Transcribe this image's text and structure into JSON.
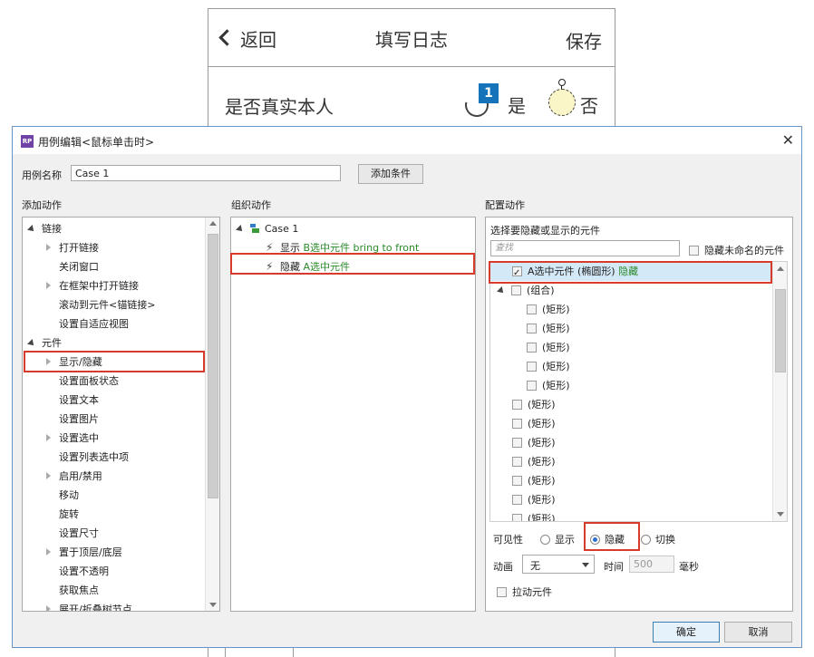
{
  "phone": {
    "back": "返回",
    "title": "填写日志",
    "save": "保存",
    "question": "是否真实本人",
    "badge": "1",
    "yes": "是",
    "no": "否"
  },
  "dialog": {
    "logo": "RP",
    "title": "用例编辑<鼠标单击时>",
    "close": "✕",
    "case_name_label": "用例名称",
    "case_name_value": "Case 1",
    "add_condition": "添加条件",
    "add_action_header": "添加动作",
    "organize_header": "组织动作",
    "configure_header": "配置动作",
    "add_action_tree": [
      {
        "label": "链接",
        "level": 0,
        "toggle": "open"
      },
      {
        "label": "打开链接",
        "level": 1,
        "toggle": "closed"
      },
      {
        "label": "关闭窗口",
        "level": 1,
        "toggle": "none"
      },
      {
        "label": "在框架中打开链接",
        "level": 1,
        "toggle": "closed"
      },
      {
        "label": "滚动到元件<锚链接>",
        "level": 1,
        "toggle": "none"
      },
      {
        "label": "设置自适应视图",
        "level": 1,
        "toggle": "none"
      },
      {
        "label": "元件",
        "level": 0,
        "toggle": "open"
      },
      {
        "label": "显示/隐藏",
        "level": 1,
        "toggle": "closed"
      },
      {
        "label": "设置面板状态",
        "level": 1,
        "toggle": "none"
      },
      {
        "label": "设置文本",
        "level": 1,
        "toggle": "none"
      },
      {
        "label": "设置图片",
        "level": 1,
        "toggle": "none"
      },
      {
        "label": "设置选中",
        "level": 1,
        "toggle": "closed"
      },
      {
        "label": "设置列表选中项",
        "level": 1,
        "toggle": "none"
      },
      {
        "label": "启用/禁用",
        "level": 1,
        "toggle": "closed"
      },
      {
        "label": "移动",
        "level": 1,
        "toggle": "none"
      },
      {
        "label": "旋转",
        "level": 1,
        "toggle": "none"
      },
      {
        "label": "设置尺寸",
        "level": 1,
        "toggle": "none"
      },
      {
        "label": "置于顶层/底层",
        "level": 1,
        "toggle": "closed"
      },
      {
        "label": "设置不透明",
        "level": 1,
        "toggle": "none"
      },
      {
        "label": "获取焦点",
        "level": 1,
        "toggle": "none"
      },
      {
        "label": "展开/折叠树节点",
        "level": 1,
        "toggle": "closed"
      }
    ],
    "organize": {
      "case_label": "Case 1",
      "actions": [
        {
          "verb": "显示",
          "target": "B选中元件 bring to front"
        },
        {
          "verb": "隐藏",
          "target": "A选中元件"
        }
      ]
    },
    "configure": {
      "select_label": "选择要隐藏或显示的元件",
      "search_placeholder": "查找",
      "hide_unnamed": "隐藏未命名的元件",
      "widgets": [
        {
          "label": "A选中元件 (椭圆形)",
          "status": "隐藏",
          "checked": true,
          "level": 0,
          "toggle": "none"
        },
        {
          "label": "(组合)",
          "status": "",
          "checked": false,
          "level": 0,
          "toggle": "open"
        },
        {
          "label": "(矩形)",
          "status": "",
          "checked": false,
          "level": 1,
          "toggle": "none"
        },
        {
          "label": "(矩形)",
          "status": "",
          "checked": false,
          "level": 1,
          "toggle": "none"
        },
        {
          "label": "(矩形)",
          "status": "",
          "checked": false,
          "level": 1,
          "toggle": "none"
        },
        {
          "label": "(矩形)",
          "status": "",
          "checked": false,
          "level": 1,
          "toggle": "none"
        },
        {
          "label": "(矩形)",
          "status": "",
          "checked": false,
          "level": 1,
          "toggle": "none"
        },
        {
          "label": "(矩形)",
          "status": "",
          "checked": false,
          "level": 0,
          "toggle": "none"
        },
        {
          "label": "(矩形)",
          "status": "",
          "checked": false,
          "level": 0,
          "toggle": "none"
        },
        {
          "label": "(矩形)",
          "status": "",
          "checked": false,
          "level": 0,
          "toggle": "none"
        },
        {
          "label": "(矩形)",
          "status": "",
          "checked": false,
          "level": 0,
          "toggle": "none"
        },
        {
          "label": "(矩形)",
          "status": "",
          "checked": false,
          "level": 0,
          "toggle": "none"
        },
        {
          "label": "(矩形)",
          "status": "",
          "checked": false,
          "level": 0,
          "toggle": "none"
        },
        {
          "label": "(矩形)",
          "status": "",
          "checked": false,
          "level": 0,
          "toggle": "none"
        }
      ],
      "visibility_label": "可见性",
      "visibility_options": [
        "显示",
        "隐藏",
        "切换"
      ],
      "visibility_selected": "隐藏",
      "animation_label": "动画",
      "animation_value": "无",
      "time_label": "时间",
      "time_value": "500",
      "time_unit": "毫秒",
      "pull_widgets": "拉动元件"
    },
    "ok": "确定",
    "cancel": "取消"
  },
  "colors": {
    "highlight_red": "#d63b2c",
    "selection_blue": "#d4e9f8",
    "green_text": "#2a8a2a",
    "badge_blue": "#1473b9"
  }
}
